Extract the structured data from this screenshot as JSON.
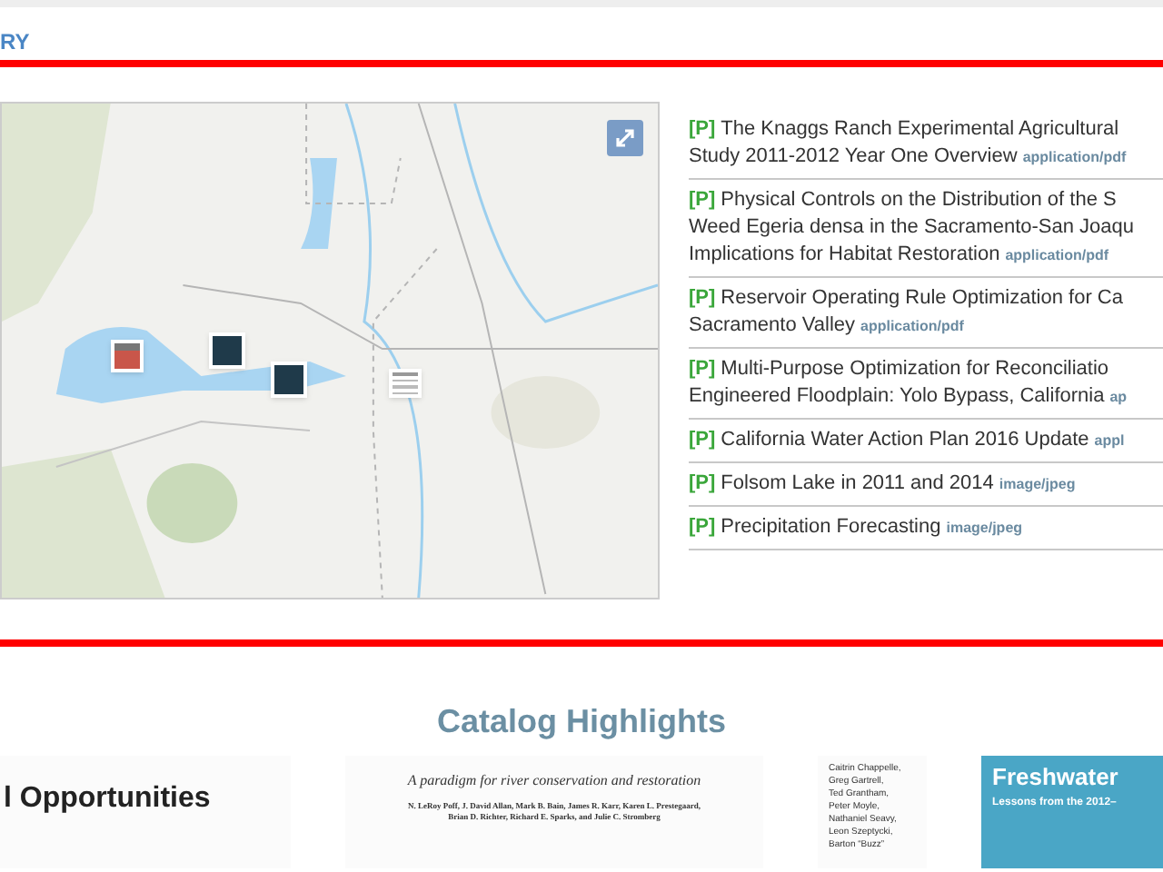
{
  "header": {
    "title": "RY"
  },
  "map": {
    "kind": "picture",
    "markers": [
      {
        "kind": "document"
      },
      {
        "kind": "water"
      },
      {
        "kind": "water"
      },
      {
        "kind": "page"
      }
    ]
  },
  "resources": [
    {
      "badge": "[P]",
      "lines": [
        "The Knaggs Ranch Experimental Agricultural",
        "Study 2011-2012 Year One Overview"
      ],
      "mime": "application/pdf"
    },
    {
      "badge": "[P]",
      "lines": [
        "Physical Controls on the Distribution of the S",
        "Weed Egeria densa in the Sacramento-San Joaqu",
        "Implications for Habitat Restoration"
      ],
      "mime": "application/pdf"
    },
    {
      "badge": "[P]",
      "lines": [
        "Reservoir Operating Rule Optimization for Ca",
        "Sacramento Valley"
      ],
      "mime": "application/pdf"
    },
    {
      "badge": "[P]",
      "lines": [
        "Multi-Purpose Optimization for Reconciliatio",
        "Engineered Floodplain: Yolo Bypass, California"
      ],
      "mime": "ap"
    },
    {
      "badge": "[P]",
      "lines": [
        "California Water Action Plan 2016 Update"
      ],
      "mime": "appl"
    },
    {
      "badge": "[P]",
      "lines": [
        "Folsom Lake in 2011 and 2014"
      ],
      "mime": "image/jpeg"
    },
    {
      "badge": "[P]",
      "lines": [
        "Precipitation Forecasting"
      ],
      "mime": "image/jpeg"
    }
  ],
  "highlights": {
    "title": "Catalog Highlights",
    "cards": [
      {
        "kind": "title",
        "heading": "l Opportunities"
      },
      {
        "kind": "article",
        "subtitle": "A paradigm for river conservation and restoration",
        "authors": [
          "N. LeRoy Poff, J. David Allan, Mark B. Bain, James R. Karr, Karen L. Prestegaard,",
          "Brian D. Richter, Richard E. Sparks, and Julie C. Stromberg"
        ]
      },
      {
        "kind": "names",
        "names": [
          "Caitrin Chappelle,",
          "Greg Gartrell,",
          "Ted Grantham,",
          "Peter Moyle,",
          "Nathaniel Seavy,",
          "Leon Szeptycki,",
          "Barton “Buzz”"
        ]
      },
      {
        "kind": "cover",
        "heading": "Freshwater",
        "subtitle": "Lessons from the 2012–"
      }
    ]
  }
}
